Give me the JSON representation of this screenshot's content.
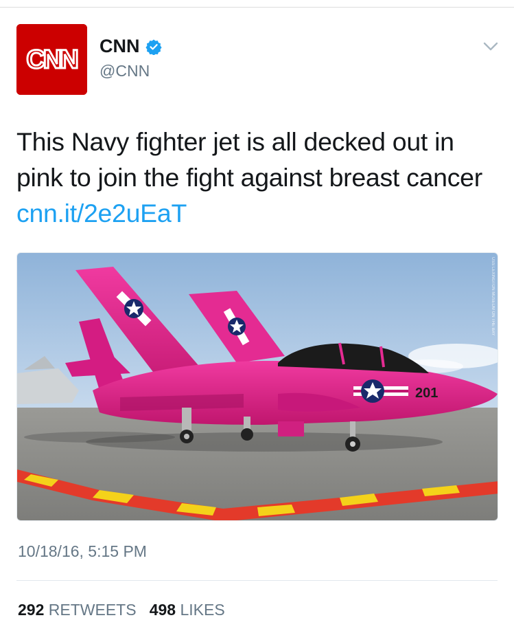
{
  "author": {
    "avatar_text": "CNN",
    "display_name": "CNN",
    "handle": "@CNN",
    "avatar_color": "#cc0000",
    "verified_color": "#1da1f2"
  },
  "tweet": {
    "text": "This Navy fighter jet is all decked out in pink to join the fight against breast cancer ",
    "link": "cnn.it/2e2uEaT",
    "media": {
      "tail_number": "201",
      "credit": "USS LEXINGTON MUSEUM ON THE BAY"
    },
    "timestamp": "10/18/16, 5:15 PM"
  },
  "stats": {
    "retweets_count": "292",
    "retweets_label": "RETWEETS",
    "likes_count": "498",
    "likes_label": "LIKES"
  },
  "colors": {
    "link": "#1da1f2",
    "secondary_text": "#657786",
    "jet_pink": "#e0208a"
  }
}
